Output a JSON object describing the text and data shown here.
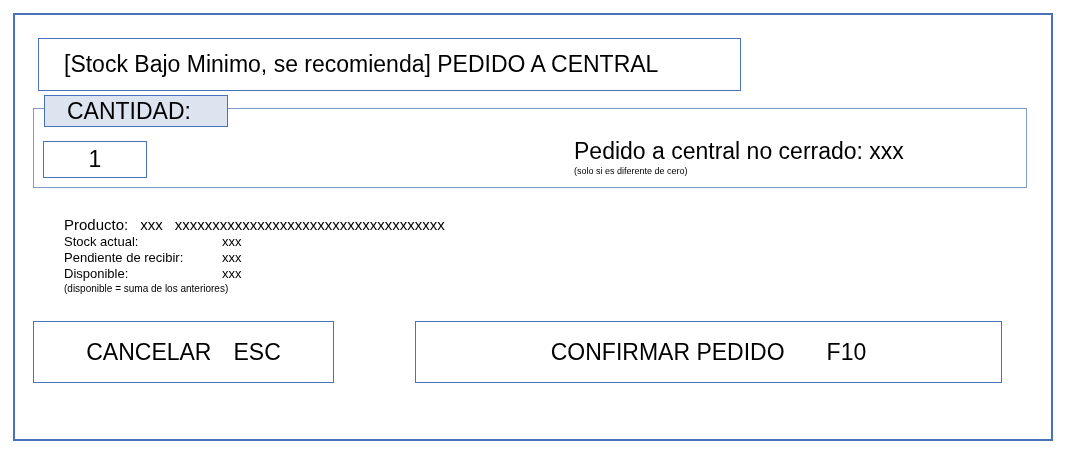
{
  "title": "[Stock Bajo Minimo, se recomienda] PEDIDO A CENTRAL",
  "quantity": {
    "label": "CANTIDAD:",
    "value": "1"
  },
  "pending": {
    "text": "Pedido a central no cerrado: xxx",
    "note": "(solo si es diferente de cero)"
  },
  "product": {
    "label": "Producto:",
    "code": "xxx",
    "name": "xxxxxxxxxxxxxxxxxxxxxxxxxxxxxxxxxxxx"
  },
  "details": [
    {
      "label": "Stock actual:",
      "value": "xxx"
    },
    {
      "label": "Pendiente de recibir:",
      "value": "xxx"
    },
    {
      "label": "Disponible:",
      "value": "xxx"
    }
  ],
  "details_note": "(disponible = suma de los anteriores)",
  "buttons": [
    {
      "label": "CANCELAR",
      "key": "ESC",
      "kind": "cancel"
    },
    {
      "label": "CONFIRMAR PEDIDO",
      "key": "F10",
      "kind": "confirm"
    }
  ]
}
